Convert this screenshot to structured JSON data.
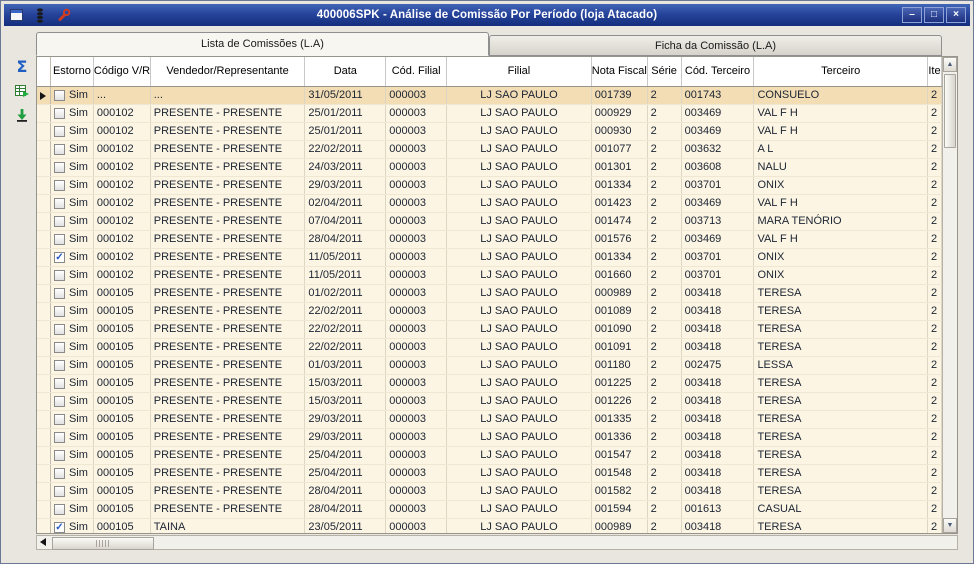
{
  "window": {
    "title": "400006SPK - Análise de Comissão Por Período (loja Atacado)",
    "title_icons": [
      "form-icon",
      "beads-icon",
      "wrench-icon"
    ],
    "controls": [
      {
        "name": "minimize",
        "glyph": "–"
      },
      {
        "name": "maximize",
        "glyph": "□"
      },
      {
        "name": "close",
        "glyph": "×"
      }
    ]
  },
  "tabs": [
    {
      "label": "Lista de Comissões (L.A)",
      "active": true
    },
    {
      "label": "Ficha da Comissão (L.A)",
      "active": false
    }
  ],
  "side_toolbar": [
    {
      "name": "sum-icon",
      "glyph": "Σ"
    },
    {
      "name": "export-grid-icon"
    },
    {
      "name": "export-down-icon"
    }
  ],
  "scrollbars": {
    "up_glyph": "▲",
    "down_glyph": "▼"
  },
  "grid": {
    "columns": [
      "",
      "Estorno",
      "Código V/R",
      "Vendedor/Representante",
      "Data",
      "Cód. Filial",
      "Filial",
      "Nota Fiscal",
      "Série",
      "Cód. Terceiro",
      "Terceiro",
      "Ite"
    ],
    "rows": [
      {
        "selected": true,
        "checked": false,
        "estorno": "Sim",
        "codigo_vr": "...",
        "vendedor": "...",
        "data": "31/05/2011",
        "cod_filial": "000003",
        "filial": "LJ SAO PAULO",
        "nota_fiscal": "001739",
        "serie": "2",
        "cod_terceiro": "001743",
        "terceiro": "CONSUELO",
        "item": "2"
      },
      {
        "selected": false,
        "checked": false,
        "estorno": "Sim",
        "codigo_vr": "000102",
        "vendedor": "PRESENTE - PRESENTE",
        "data": "25/01/2011",
        "cod_filial": "000003",
        "filial": "LJ SAO PAULO",
        "nota_fiscal": "000929",
        "serie": "2",
        "cod_terceiro": "003469",
        "terceiro": "VAL F H",
        "item": "2"
      },
      {
        "selected": false,
        "checked": false,
        "estorno": "Sim",
        "codigo_vr": "000102",
        "vendedor": "PRESENTE - PRESENTE",
        "data": "25/01/2011",
        "cod_filial": "000003",
        "filial": "LJ SAO PAULO",
        "nota_fiscal": "000930",
        "serie": "2",
        "cod_terceiro": "003469",
        "terceiro": "VAL F H",
        "item": "2"
      },
      {
        "selected": false,
        "checked": false,
        "estorno": "Sim",
        "codigo_vr": "000102",
        "vendedor": "PRESENTE - PRESENTE",
        "data": "22/02/2011",
        "cod_filial": "000003",
        "filial": "LJ SAO PAULO",
        "nota_fiscal": "001077",
        "serie": "2",
        "cod_terceiro": "003632",
        "terceiro": "A L",
        "item": "2"
      },
      {
        "selected": false,
        "checked": false,
        "estorno": "Sim",
        "codigo_vr": "000102",
        "vendedor": "PRESENTE - PRESENTE",
        "data": "24/03/2011",
        "cod_filial": "000003",
        "filial": "LJ SAO PAULO",
        "nota_fiscal": "001301",
        "serie": "2",
        "cod_terceiro": "003608",
        "terceiro": "NALU",
        "item": "2"
      },
      {
        "selected": false,
        "checked": false,
        "estorno": "Sim",
        "codigo_vr": "000102",
        "vendedor": "PRESENTE - PRESENTE",
        "data": "29/03/2011",
        "cod_filial": "000003",
        "filial": "LJ SAO PAULO",
        "nota_fiscal": "001334",
        "serie": "2",
        "cod_terceiro": "003701",
        "terceiro": "ONIX",
        "item": "2"
      },
      {
        "selected": false,
        "checked": false,
        "estorno": "Sim",
        "codigo_vr": "000102",
        "vendedor": "PRESENTE - PRESENTE",
        "data": "02/04/2011",
        "cod_filial": "000003",
        "filial": "LJ SAO PAULO",
        "nota_fiscal": "001423",
        "serie": "2",
        "cod_terceiro": "003469",
        "terceiro": "VAL F H",
        "item": "2"
      },
      {
        "selected": false,
        "checked": false,
        "estorno": "Sim",
        "codigo_vr": "000102",
        "vendedor": "PRESENTE - PRESENTE",
        "data": "07/04/2011",
        "cod_filial": "000003",
        "filial": "LJ SAO PAULO",
        "nota_fiscal": "001474",
        "serie": "2",
        "cod_terceiro": "003713",
        "terceiro": "MARA TENÓRIO",
        "item": "2"
      },
      {
        "selected": false,
        "checked": false,
        "estorno": "Sim",
        "codigo_vr": "000102",
        "vendedor": "PRESENTE - PRESENTE",
        "data": "28/04/2011",
        "cod_filial": "000003",
        "filial": "LJ SAO PAULO",
        "nota_fiscal": "001576",
        "serie": "2",
        "cod_terceiro": "003469",
        "terceiro": "VAL F H",
        "item": "2"
      },
      {
        "selected": false,
        "checked": true,
        "estorno": "Sim",
        "codigo_vr": "000102",
        "vendedor": "PRESENTE - PRESENTE",
        "data": "11/05/2011",
        "cod_filial": "000003",
        "filial": "LJ SAO PAULO",
        "nota_fiscal": "001334",
        "serie": "2",
        "cod_terceiro": "003701",
        "terceiro": "ONIX",
        "item": "2"
      },
      {
        "selected": false,
        "checked": false,
        "estorno": "Sim",
        "codigo_vr": "000102",
        "vendedor": "PRESENTE - PRESENTE",
        "data": "11/05/2011",
        "cod_filial": "000003",
        "filial": "LJ SAO PAULO",
        "nota_fiscal": "001660",
        "serie": "2",
        "cod_terceiro": "003701",
        "terceiro": "ONIX",
        "item": "2"
      },
      {
        "selected": false,
        "checked": false,
        "estorno": "Sim",
        "codigo_vr": "000105",
        "vendedor": "PRESENTE - PRESENTE",
        "data": "01/02/2011",
        "cod_filial": "000003",
        "filial": "LJ SAO PAULO",
        "nota_fiscal": "000989",
        "serie": "2",
        "cod_terceiro": "003418",
        "terceiro": "TERESA",
        "item": "2"
      },
      {
        "selected": false,
        "checked": false,
        "estorno": "Sim",
        "codigo_vr": "000105",
        "vendedor": "PRESENTE - PRESENTE",
        "data": "22/02/2011",
        "cod_filial": "000003",
        "filial": "LJ SAO PAULO",
        "nota_fiscal": "001089",
        "serie": "2",
        "cod_terceiro": "003418",
        "terceiro": "TERESA",
        "item": "2"
      },
      {
        "selected": false,
        "checked": false,
        "estorno": "Sim",
        "codigo_vr": "000105",
        "vendedor": "PRESENTE - PRESENTE",
        "data": "22/02/2011",
        "cod_filial": "000003",
        "filial": "LJ SAO PAULO",
        "nota_fiscal": "001090",
        "serie": "2",
        "cod_terceiro": "003418",
        "terceiro": "TERESA",
        "item": "2"
      },
      {
        "selected": false,
        "checked": false,
        "estorno": "Sim",
        "codigo_vr": "000105",
        "vendedor": "PRESENTE - PRESENTE",
        "data": "22/02/2011",
        "cod_filial": "000003",
        "filial": "LJ SAO PAULO",
        "nota_fiscal": "001091",
        "serie": "2",
        "cod_terceiro": "003418",
        "terceiro": "TERESA",
        "item": "2"
      },
      {
        "selected": false,
        "checked": false,
        "estorno": "Sim",
        "codigo_vr": "000105",
        "vendedor": "PRESENTE - PRESENTE",
        "data": "01/03/2011",
        "cod_filial": "000003",
        "filial": "LJ SAO PAULO",
        "nota_fiscal": "001180",
        "serie": "2",
        "cod_terceiro": "002475",
        "terceiro": "LESSA",
        "item": "2"
      },
      {
        "selected": false,
        "checked": false,
        "estorno": "Sim",
        "codigo_vr": "000105",
        "vendedor": "PRESENTE - PRESENTE",
        "data": "15/03/2011",
        "cod_filial": "000003",
        "filial": "LJ SAO PAULO",
        "nota_fiscal": "001225",
        "serie": "2",
        "cod_terceiro": "003418",
        "terceiro": "TERESA",
        "item": "2"
      },
      {
        "selected": false,
        "checked": false,
        "estorno": "Sim",
        "codigo_vr": "000105",
        "vendedor": "PRESENTE - PRESENTE",
        "data": "15/03/2011",
        "cod_filial": "000003",
        "filial": "LJ SAO PAULO",
        "nota_fiscal": "001226",
        "serie": "2",
        "cod_terceiro": "003418",
        "terceiro": "TERESA",
        "item": "2"
      },
      {
        "selected": false,
        "checked": false,
        "estorno": "Sim",
        "codigo_vr": "000105",
        "vendedor": "PRESENTE - PRESENTE",
        "data": "29/03/2011",
        "cod_filial": "000003",
        "filial": "LJ SAO PAULO",
        "nota_fiscal": "001335",
        "serie": "2",
        "cod_terceiro": "003418",
        "terceiro": "TERESA",
        "item": "2"
      },
      {
        "selected": false,
        "checked": false,
        "estorno": "Sim",
        "codigo_vr": "000105",
        "vendedor": "PRESENTE - PRESENTE",
        "data": "29/03/2011",
        "cod_filial": "000003",
        "filial": "LJ SAO PAULO",
        "nota_fiscal": "001336",
        "serie": "2",
        "cod_terceiro": "003418",
        "terceiro": "TERESA",
        "item": "2"
      },
      {
        "selected": false,
        "checked": false,
        "estorno": "Sim",
        "codigo_vr": "000105",
        "vendedor": "PRESENTE - PRESENTE",
        "data": "25/04/2011",
        "cod_filial": "000003",
        "filial": "LJ SAO PAULO",
        "nota_fiscal": "001547",
        "serie": "2",
        "cod_terceiro": "003418",
        "terceiro": "TERESA",
        "item": "2"
      },
      {
        "selected": false,
        "checked": false,
        "estorno": "Sim",
        "codigo_vr": "000105",
        "vendedor": "PRESENTE - PRESENTE",
        "data": "25/04/2011",
        "cod_filial": "000003",
        "filial": "LJ SAO PAULO",
        "nota_fiscal": "001548",
        "serie": "2",
        "cod_terceiro": "003418",
        "terceiro": "TERESA",
        "item": "2"
      },
      {
        "selected": false,
        "checked": false,
        "estorno": "Sim",
        "codigo_vr": "000105",
        "vendedor": "PRESENTE - PRESENTE",
        "data": "28/04/2011",
        "cod_filial": "000003",
        "filial": "LJ SAO PAULO",
        "nota_fiscal": "001582",
        "serie": "2",
        "cod_terceiro": "003418",
        "terceiro": "TERESA",
        "item": "2"
      },
      {
        "selected": false,
        "checked": false,
        "estorno": "Sim",
        "codigo_vr": "000105",
        "vendedor": "PRESENTE - PRESENTE",
        "data": "28/04/2011",
        "cod_filial": "000003",
        "filial": "LJ SAO PAULO",
        "nota_fiscal": "001594",
        "serie": "2",
        "cod_terceiro": "001613",
        "terceiro": "CASUAL",
        "item": "2"
      },
      {
        "selected": false,
        "checked": true,
        "estorno": "Sim",
        "codigo_vr": "000105",
        "vendedor": "TAINA",
        "data": "23/05/2011",
        "cod_filial": "000003",
        "filial": "LJ SAO PAULO",
        "nota_fiscal": "000989",
        "serie": "2",
        "cod_terceiro": "003418",
        "terceiro": "TERESA",
        "item": "2"
      }
    ]
  }
}
